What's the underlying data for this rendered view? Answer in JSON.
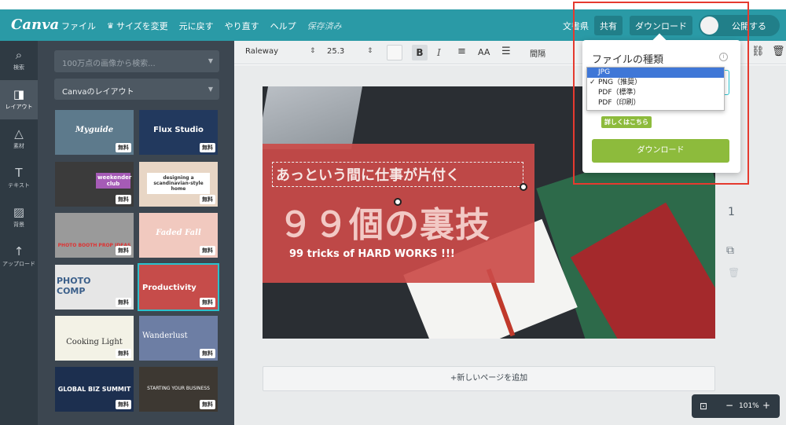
{
  "topbar": {
    "logo": "Canva",
    "menu": [
      {
        "label": "ファイル"
      },
      {
        "label": "サイズを変更",
        "icon": "crown-icon"
      },
      {
        "label": "元に戻す"
      },
      {
        "label": "やり直す"
      },
      {
        "label": "ヘルプ"
      },
      {
        "label": "保存済み"
      }
    ],
    "doc_name": "文書県",
    "share": "共有",
    "download": "ダウンロード",
    "publish": "公開する",
    "color": "#2a9aa6"
  },
  "rail": [
    {
      "label": "検索",
      "icon": "search-icon"
    },
    {
      "label": "レイアウト",
      "icon": "layout-icon",
      "active": true
    },
    {
      "label": "素材",
      "icon": "shapes-icon"
    },
    {
      "label": "テキスト",
      "icon": "text-icon"
    },
    {
      "label": "背景",
      "icon": "background-icon"
    },
    {
      "label": "アップロード",
      "icon": "upload-icon"
    }
  ],
  "panel": {
    "search_placeholder": "100万点の画像から検索...",
    "layout_select": "Canvaのレイアウト",
    "free_badge": "無料",
    "thumbs": [
      {
        "title": "Myguide",
        "color": "#5d7a8c"
      },
      {
        "title": "Flux Studio",
        "color": "#22395e"
      },
      {
        "title": "weekender club",
        "color": "#3b3b3b"
      },
      {
        "title": "designing a scandinavian-style home",
        "color": "#e8d6c5"
      },
      {
        "title": "PHOTO BOOTH PROP IDEAS",
        "color": "#9a9a9a"
      },
      {
        "title": "Faded Fall",
        "color": "#f1c9bf"
      },
      {
        "title": "PHOTO COMP",
        "color": "#e6e6e6"
      },
      {
        "title": "Productivity",
        "color": "#c64c4a"
      },
      {
        "title": "Cooking Light",
        "color": "#f3f2e6"
      },
      {
        "title": "Wanderlust",
        "color": "#6d7ea4"
      },
      {
        "title": "GLOBAL BIZ SUMMIT",
        "color": "#1c2f4f"
      },
      {
        "title": "STARTING YOUR BUSINESS",
        "color": "#3d3832"
      }
    ]
  },
  "toolbar": {
    "font": "Raleway",
    "size": "25.3",
    "bold": "B",
    "italic": "I",
    "case": "AA",
    "spacing": "間隔"
  },
  "design": {
    "line1": "あっという間に仕事が片付く",
    "line2": "９９個の裏技",
    "line3": "99 tricks of HARD WORKS !!!"
  },
  "page": {
    "number": "1",
    "add_page": "+新しいページを追加"
  },
  "zoom": {
    "level": "101%",
    "minus": "−",
    "plus": "+"
  },
  "popover": {
    "title": "ファイルの種類",
    "learn_more": "詳しくはこちら",
    "download": "ダウンロード",
    "options": [
      {
        "label": "JPG",
        "highlighted": true,
        "checked": false
      },
      {
        "label": "PNG（推奨）",
        "highlighted": false,
        "checked": true
      },
      {
        "label": "PDF（標準）",
        "highlighted": false,
        "checked": false
      },
      {
        "label": "PDF（印刷）",
        "highlighted": false,
        "checked": false
      }
    ],
    "accent": "#8dbb3c"
  }
}
